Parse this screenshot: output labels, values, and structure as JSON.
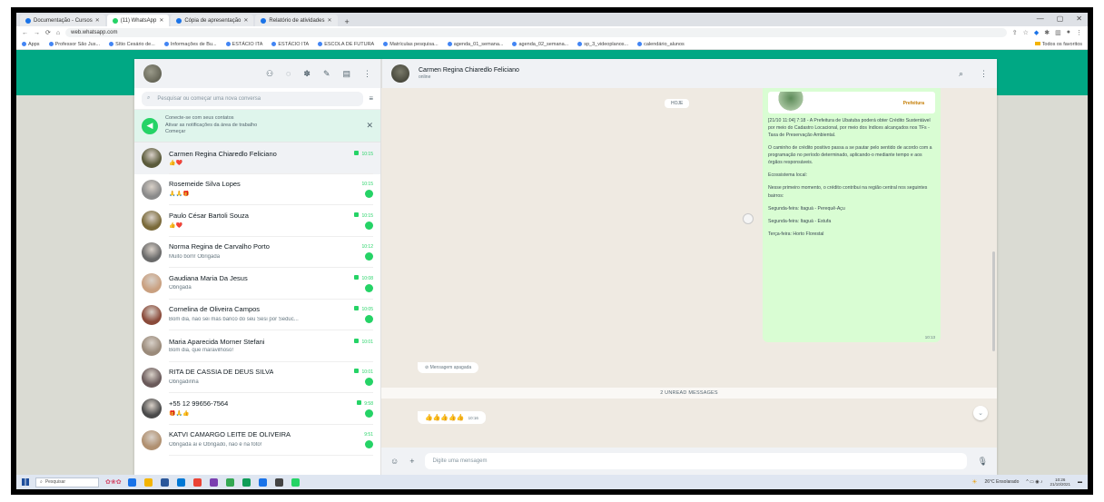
{
  "browser": {
    "tabs": [
      {
        "label": "Documentação - Cursos",
        "color": "#1a73e8",
        "active": false
      },
      {
        "label": "(11) WhatsApp",
        "color": "#25d366",
        "active": true
      },
      {
        "label": "Cópia de apresentação",
        "color": "#1a73e8",
        "active": false
      },
      {
        "label": "Relatório de atividades",
        "color": "#1a73e8",
        "active": false
      }
    ],
    "new_tab": "+",
    "address": "web.whatsapp.com",
    "bookmarks": [
      "Apps",
      "Professor São Jus...",
      "Sítio Cesário de...",
      "Informações de Bu...",
      "ESTÁCIO ITA",
      "ESTÁCIO ITA",
      "ESCOLA DE FUTURA",
      "Matrículas pesquisa...",
      "agenda_01_semana...",
      "agenda_02_semana...",
      "sp_3_videoplanos...",
      "calendário_alunos",
      "Todos os favoritos"
    ]
  },
  "sidebar": {
    "search_placeholder": "Pesquisar ou começar uma nova conversa",
    "notice": {
      "line1": "Conecte-se com seus contatos",
      "line2": "Ativar as notificações da área de trabalho",
      "line3": "Começar"
    },
    "chats": [
      {
        "name": "Carmen Regina Chiaredlo Feliciano",
        "preview": "👍❤️",
        "time": "10:15",
        "avatar": "#5a5a3a",
        "selected": true,
        "badge": false,
        "pin": true
      },
      {
        "name": "Rosemeide Silva Lopes",
        "preview": "🙏🙏🎁",
        "time": "10:15",
        "avatar": "#8a8a8a",
        "selected": false,
        "badge": true,
        "pin": false
      },
      {
        "name": "Paulo César Bartoli Souza",
        "preview": "👍❤️",
        "time": "10:15",
        "avatar": "#7a6a3a",
        "selected": false,
        "badge": true,
        "pin": true
      },
      {
        "name": "Norma Regina de Carvalho Porto",
        "preview": "Muito bom! Obrigada",
        "time": "10:12",
        "avatar": "#6a6a6a",
        "selected": false,
        "badge": true,
        "pin": false
      },
      {
        "name": "Gaudiana Maria Da Jesus",
        "preview": "Obrigada",
        "time": "10:08",
        "avatar": "#c9a080",
        "selected": false,
        "badge": true,
        "pin": true
      },
      {
        "name": "Cornelina de Oliveira Campos",
        "preview": "Bom dia, não sei mas banco do seu Sesi por Seduc...",
        "time": "10:05",
        "avatar": "#8a4a3a",
        "selected": false,
        "badge": true,
        "pin": true
      },
      {
        "name": "Maria Aparecida Morner Stefani",
        "preview": "Bom dia, que maravilhoso!",
        "time": "10:01",
        "avatar": "#9a8a7a",
        "selected": false,
        "badge": false,
        "pin": true
      },
      {
        "name": "RITA DE CASSIA DE DEUS SILVA",
        "preview": "Obrigadinha",
        "time": "10:01",
        "avatar": "#6a5a5a",
        "selected": false,
        "badge": true,
        "pin": true
      },
      {
        "name": "+55 12 99656-7564",
        "preview": "🎁🙏👍",
        "time": "9:58",
        "avatar": "#4a4a4a",
        "selected": false,
        "badge": true,
        "pin": true
      },
      {
        "name": "KATVI CAMARGO LEITE DE OLIVEIRA",
        "preview": "Obrigada ai e Obrigado, não é na foto!",
        "time": "9:51",
        "avatar": "#b09070",
        "selected": false,
        "badge": true,
        "pin": false
      }
    ]
  },
  "conversation": {
    "name": "Carmen Regina Chiaredlo Feliciano",
    "status": "online",
    "date_chip": "HOJE",
    "outgoing": {
      "logo": "Prefeitura",
      "paragraphs": [
        "[21/10 11:04] 7:18 - A Prefeitura de Ubatuba poderá obter Crédito Sustentável por meio do Cadastro Locacional, por meio dos índices alcançados nos TFs - Taxa de Preservação Ambiental.",
        "O caminho de crédito positivo passa a se pautar pelo sentido de acordo com a programação no período determinado, aplicando-o mediante tempo e aos órgãos responsáveis.",
        "Ecossistema local:",
        "Nesse primeiro momento, o crédito contribui na região central nos seguintes bairros:",
        "Segunda-feira: Itaguá - Perequê-Açu",
        "Segunda-feira: Itaguá - Estufa",
        "Terça-feira: Horto Florestal"
      ],
      "time": "10:13"
    },
    "incoming_1": "Mensagem apagada",
    "unread_label": "2 UNREAD MESSAGES",
    "incoming_2": "👍👍👍👍👍",
    "incoming_2_time": "10:16",
    "composer_placeholder": "Digite uma mensagem"
  },
  "taskbar": {
    "search_label": "Pesquisar",
    "weather": "26°C Ensolarado",
    "time": "10:26",
    "date": "21/10/2021",
    "apps": [
      "#1a73e8",
      "#f4b400",
      "#2b579a",
      "#0078d4",
      "#ea4335",
      "#7b3fb0",
      "#34a853",
      "#0f9d58",
      "#1a73e8",
      "#444444",
      "#25d366"
    ]
  }
}
